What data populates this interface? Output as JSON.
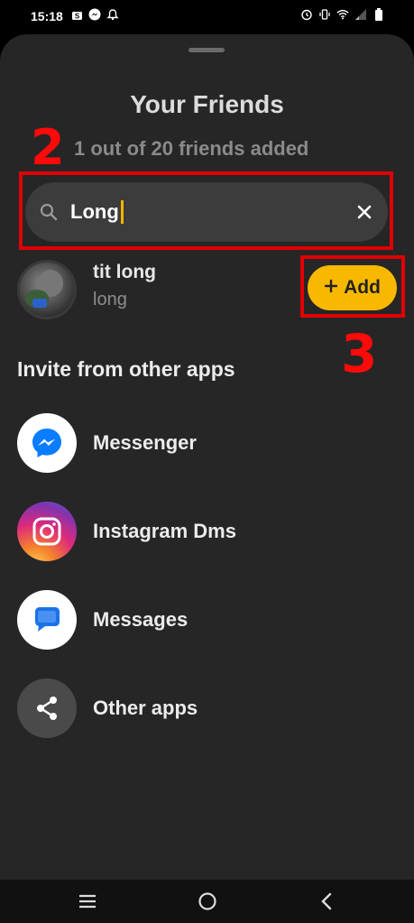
{
  "status_bar": {
    "time": "15:18",
    "left_icons": [
      "shop-icon",
      "messenger-notification-icon",
      "alarm-bell-icon"
    ],
    "right_icons": [
      "alarm-icon",
      "vibrate-icon",
      "wifi-icon",
      "signal-icon",
      "battery-icon"
    ]
  },
  "sheet": {
    "title": "Your Friends",
    "subtitle": "1 out of 20 friends added"
  },
  "annotations": {
    "step_2": "2",
    "step_3": "3",
    "color": "#ff0a0a"
  },
  "search": {
    "value": "Long",
    "icon": "search-icon",
    "clear_icon": "close-icon"
  },
  "friend_result": {
    "name": "tit long",
    "username": "long",
    "add_label": "Add",
    "add_color": "#f9b800"
  },
  "invite": {
    "section_title": "Invite from other apps",
    "apps": [
      {
        "label": "Messenger",
        "icon": "messenger-icon"
      },
      {
        "label": "Instagram Dms",
        "icon": "instagram-icon"
      },
      {
        "label": "Messages",
        "icon": "messages-icon"
      },
      {
        "label": "Other apps",
        "icon": "share-icon"
      }
    ]
  },
  "nav_bar": {
    "buttons": [
      "recent-apps-icon",
      "home-icon",
      "back-icon"
    ]
  }
}
